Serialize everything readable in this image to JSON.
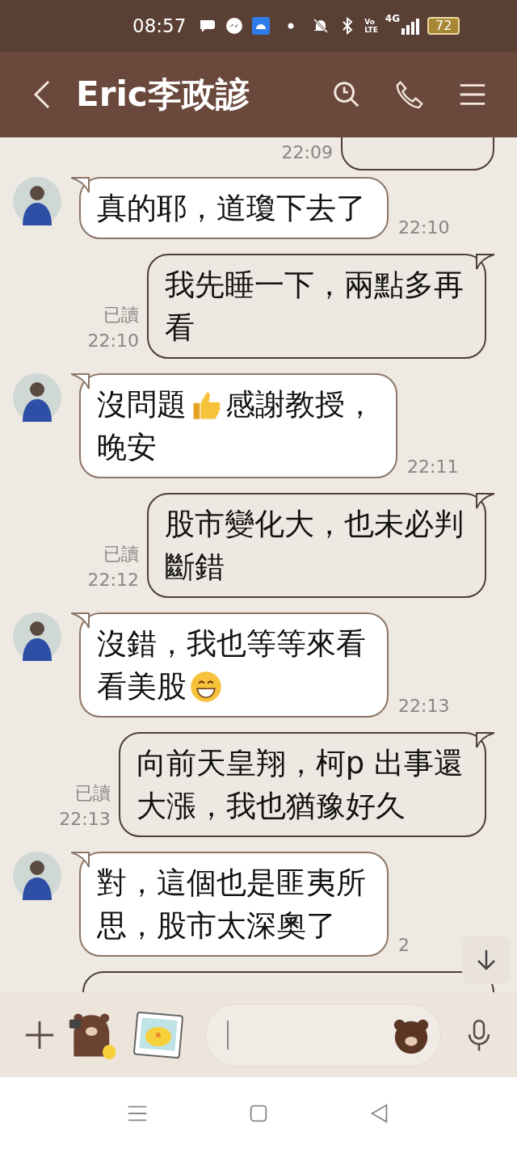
{
  "status_bar": {
    "time": "08:57",
    "volte": [
      "Vo",
      "LTE"
    ],
    "network": "4G",
    "battery": "72"
  },
  "header": {
    "title": "Eric李政諺"
  },
  "messages": [
    {
      "kind": "outgoing_cut_top",
      "time": "22:09"
    },
    {
      "kind": "incoming",
      "time": "22:10",
      "lines": [
        [
          {
            "kind": "text",
            "text": "真的耶，道瓊下去了"
          }
        ]
      ]
    },
    {
      "kind": "outgoing",
      "read": "已讀",
      "time": "22:10",
      "lines": [
        [
          {
            "kind": "text",
            "text": "我先睡一下，兩點多再"
          }
        ],
        [
          {
            "kind": "text",
            "text": "看"
          }
        ]
      ]
    },
    {
      "kind": "incoming",
      "time": "22:11",
      "lines": [
        [
          {
            "kind": "text",
            "text": "沒問題"
          },
          {
            "kind": "thumbs_up"
          },
          {
            "kind": "text",
            "text": "感謝教授，"
          }
        ],
        [
          {
            "kind": "text",
            "text": "晚安"
          }
        ]
      ]
    },
    {
      "kind": "outgoing",
      "read": "已讀",
      "time": "22:12",
      "lines": [
        [
          {
            "kind": "text",
            "text": "股市變化大，也未必判"
          }
        ],
        [
          {
            "kind": "text",
            "text": "斷錯"
          }
        ]
      ]
    },
    {
      "kind": "incoming",
      "time": "22:13",
      "lines": [
        [
          {
            "kind": "text",
            "text": "沒錯，我也等等來看"
          }
        ],
        [
          {
            "kind": "text",
            "text": "看美股"
          },
          {
            "kind": "grin"
          }
        ]
      ]
    },
    {
      "kind": "outgoing",
      "read": "已讀",
      "time": "22:13",
      "lines": [
        [
          {
            "kind": "text",
            "text": "向前天皇翔，柯p 出事還"
          }
        ],
        [
          {
            "kind": "text",
            "text": "大漲，我也猶豫好久"
          }
        ]
      ]
    },
    {
      "kind": "incoming",
      "time": "2",
      "lines": [
        [
          {
            "kind": "text",
            "text": "對，這個也是匪夷所"
          }
        ],
        [
          {
            "kind": "text",
            "text": "思，股市太深奧了"
          }
        ]
      ]
    },
    {
      "kind": "outgoing_cut_bottom"
    }
  ]
}
